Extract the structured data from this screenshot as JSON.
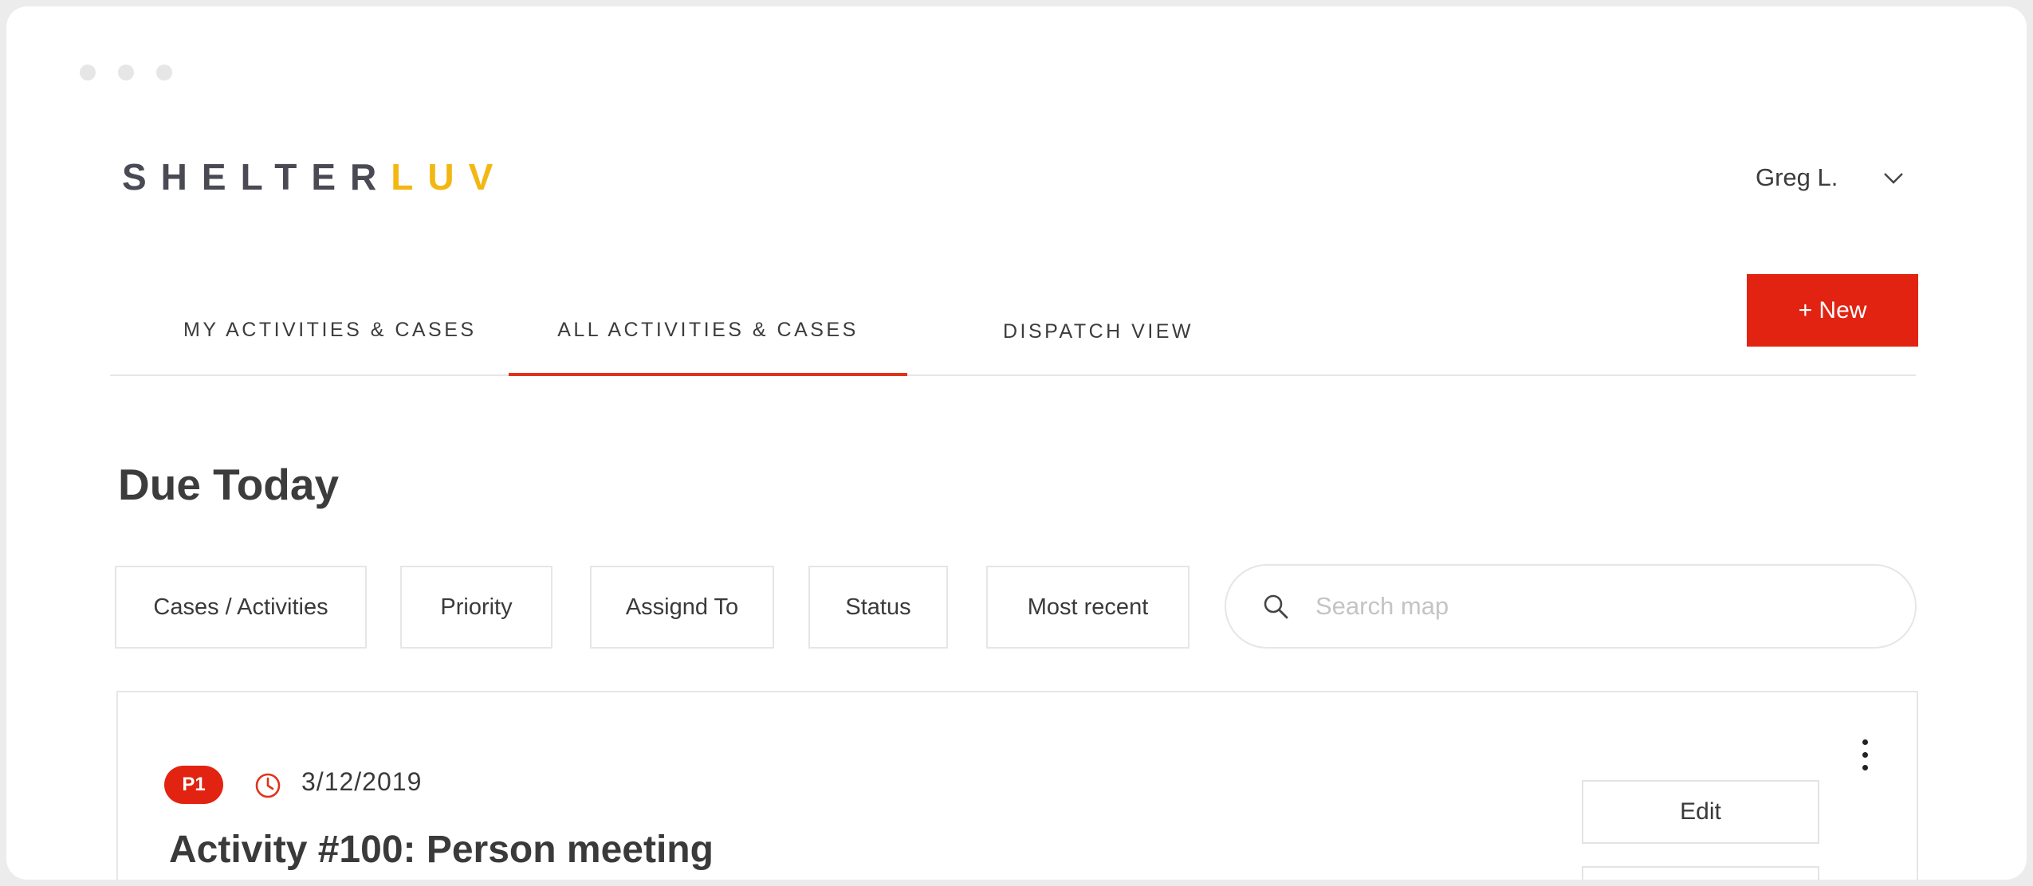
{
  "brand": {
    "part1": "SHELTER",
    "part2": "LUV",
    "color_primary": "#4a4a55",
    "color_accent": "#f3b713"
  },
  "user": {
    "name": "Greg L.",
    "menu_icon": "chevron-down-icon"
  },
  "tabs": [
    {
      "label": "MY ACTIVITIES & CASES",
      "active": false
    },
    {
      "label": "ALL ACTIVITIES & CASES",
      "active": true
    },
    {
      "label": "DISPATCH VIEW",
      "active": false
    }
  ],
  "new_button": {
    "label": "+ New",
    "color": "#e22311"
  },
  "page_title": "Due Today",
  "filters": [
    "Cases / Activities",
    "Priority",
    "Assignd To",
    "Status",
    "Most recent"
  ],
  "search": {
    "placeholder": "Search map",
    "value": "",
    "icon": "search-icon"
  },
  "activity": {
    "priority": "P1",
    "date": "3/12/2019",
    "title": "Activity #100: Person meeting",
    "edit_label": "Edit",
    "menu_icon": "more-vertical-icon",
    "due_icon": "clock-icon"
  },
  "accent_color": "#e2321b"
}
